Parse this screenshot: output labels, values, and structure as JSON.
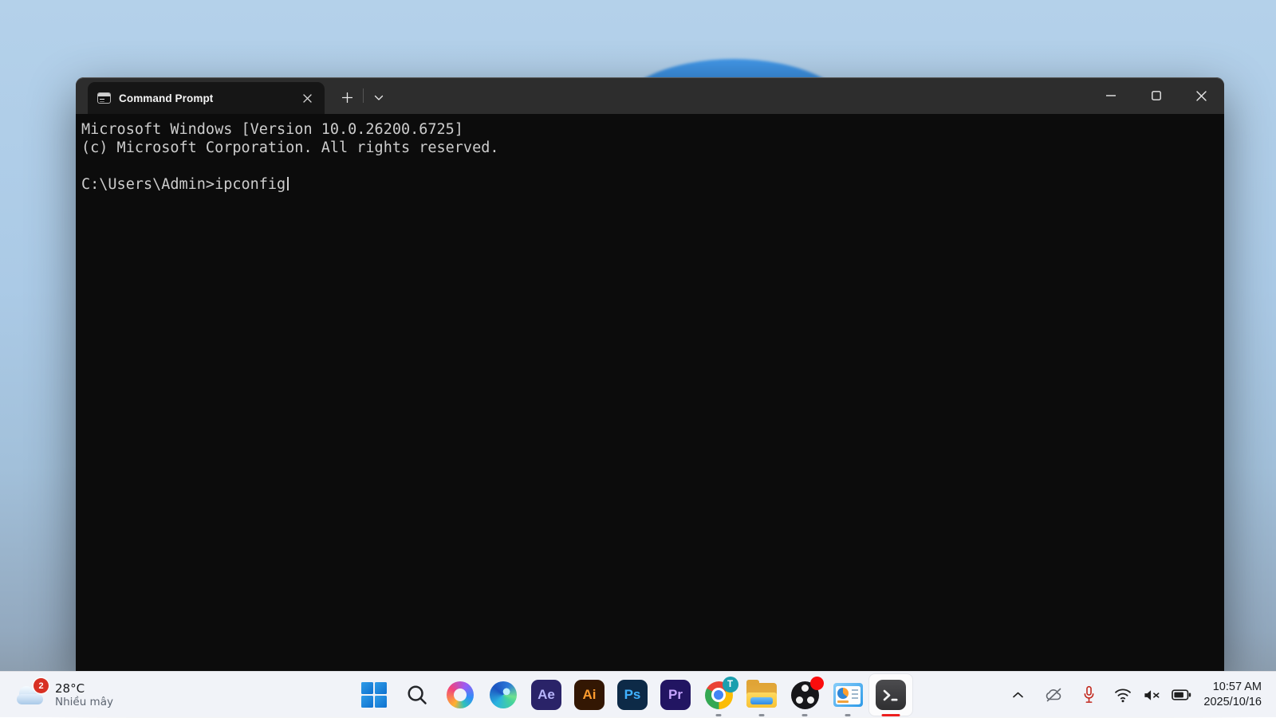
{
  "window": {
    "tab_title": "Command Prompt"
  },
  "terminal": {
    "lines": [
      "Microsoft Windows [Version 10.0.26200.6725]",
      "(c) Microsoft Corporation. All rights reserved.",
      "",
      "C:\\Users\\Admin>ipconfig"
    ]
  },
  "taskbar": {
    "weather": {
      "badge_count": "2",
      "temperature": "28°C",
      "condition": "Nhiều mây"
    },
    "apps": {
      "after_effects_label": "Ae",
      "illustrator_label": "Ai",
      "photoshop_label": "Ps",
      "premiere_label": "Pr",
      "chrome_badge": "T"
    },
    "clock": {
      "time": "10:57 AM",
      "date": "2025/10/16"
    }
  },
  "colors": {
    "titlebar": "#2d2d2d",
    "terminal_background": "#0c0c0c",
    "terminal_foreground": "#cccccc",
    "taskbar_background": "#f1f3f8",
    "active_indicator_red": "#ec1f1f",
    "wallpaper_blue": "#abcae6",
    "bloom_blue": "#1a64b2"
  }
}
